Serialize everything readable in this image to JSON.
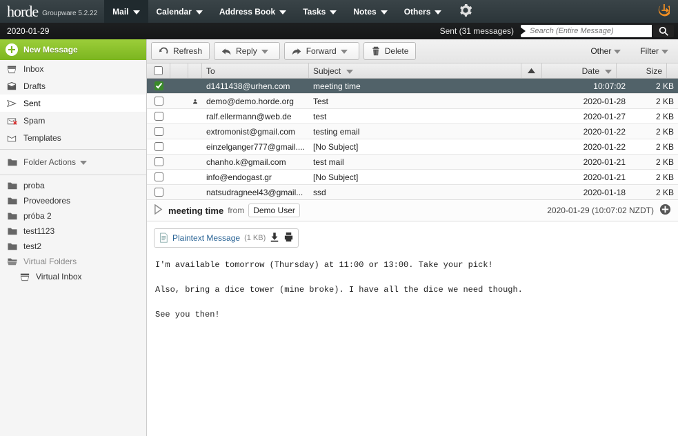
{
  "brand": {
    "name": "horde",
    "tagline": "Groupware 5.2.22"
  },
  "nav": {
    "items": [
      {
        "label": "Mail",
        "active": true
      },
      {
        "label": "Calendar",
        "active": false
      },
      {
        "label": "Address Book",
        "active": false
      },
      {
        "label": "Tasks",
        "active": false
      },
      {
        "label": "Notes",
        "active": false
      },
      {
        "label": "Others",
        "active": false
      }
    ]
  },
  "subbar": {
    "date": "2020-01-29",
    "sent_count": "Sent (31 messages)",
    "search_placeholder": "Search (Entire Message)"
  },
  "sidebar": {
    "new_message": "New Message",
    "mailboxes": [
      {
        "label": "Inbox",
        "icon": "inbox"
      },
      {
        "label": "Drafts",
        "icon": "drafts"
      },
      {
        "label": "Sent",
        "icon": "sent",
        "active": true
      },
      {
        "label": "Spam",
        "icon": "spam"
      },
      {
        "label": "Templates",
        "icon": "templates"
      }
    ],
    "folder_actions": "Folder Actions",
    "folders": [
      {
        "label": "proba"
      },
      {
        "label": "Proveedores"
      },
      {
        "label": "próba 2"
      },
      {
        "label": "test1123"
      },
      {
        "label": "test2"
      }
    ],
    "virtual_label": "Virtual Folders",
    "virtual_inbox": "Virtual Inbox"
  },
  "toolbar": {
    "refresh": "Refresh",
    "reply": "Reply",
    "forward": "Forward",
    "delete": "Delete",
    "other": "Other",
    "filter": "Filter"
  },
  "table": {
    "headers": {
      "to": "To",
      "subject": "Subject",
      "date": "Date",
      "size": "Size"
    },
    "rows": [
      {
        "selected": true,
        "checked": true,
        "person": false,
        "to": "d1411438@urhen.com",
        "subject": "meeting time",
        "date": "10:07:02",
        "size": "2 KB"
      },
      {
        "selected": false,
        "checked": false,
        "person": true,
        "to": "demo@demo.horde.org",
        "subject": "Test",
        "date": "2020-01-28",
        "size": "2 KB"
      },
      {
        "selected": false,
        "checked": false,
        "person": false,
        "to": "ralf.ellermann@web.de",
        "subject": "test",
        "date": "2020-01-27",
        "size": "2 KB"
      },
      {
        "selected": false,
        "checked": false,
        "person": false,
        "to": "extromonist@gmail.com",
        "subject": "testing email",
        "date": "2020-01-22",
        "size": "2 KB"
      },
      {
        "selected": false,
        "checked": false,
        "person": false,
        "to": "einzelganger777@gmail....",
        "subject": "[No Subject]",
        "date": "2020-01-22",
        "size": "2 KB"
      },
      {
        "selected": false,
        "checked": false,
        "person": false,
        "to": "chanho.k@gmail.com",
        "subject": "test mail",
        "date": "2020-01-21",
        "size": "2 KB"
      },
      {
        "selected": false,
        "checked": false,
        "person": false,
        "to": "info@endogast.gr",
        "subject": "[No Subject]",
        "date": "2020-01-21",
        "size": "2 KB"
      },
      {
        "selected": false,
        "checked": false,
        "person": false,
        "to": "natsudragneel43@gmail...",
        "subject": "ssd",
        "date": "2020-01-18",
        "size": "2 KB"
      }
    ]
  },
  "preview": {
    "subject": "meeting time",
    "from_label": "from",
    "from_user": "Demo User",
    "timestamp": "2020-01-29 (10:07:02 NZDT)",
    "attachment": {
      "label": "Plaintext Message",
      "size": "(1 KB)"
    },
    "body": "I'm available tomorrow (Thursday) at 11:00 or 13:00. Take your pick!\n\nAlso, bring a dice tower (mine broke). I have all the dice we need though.\n\nSee you then!"
  }
}
